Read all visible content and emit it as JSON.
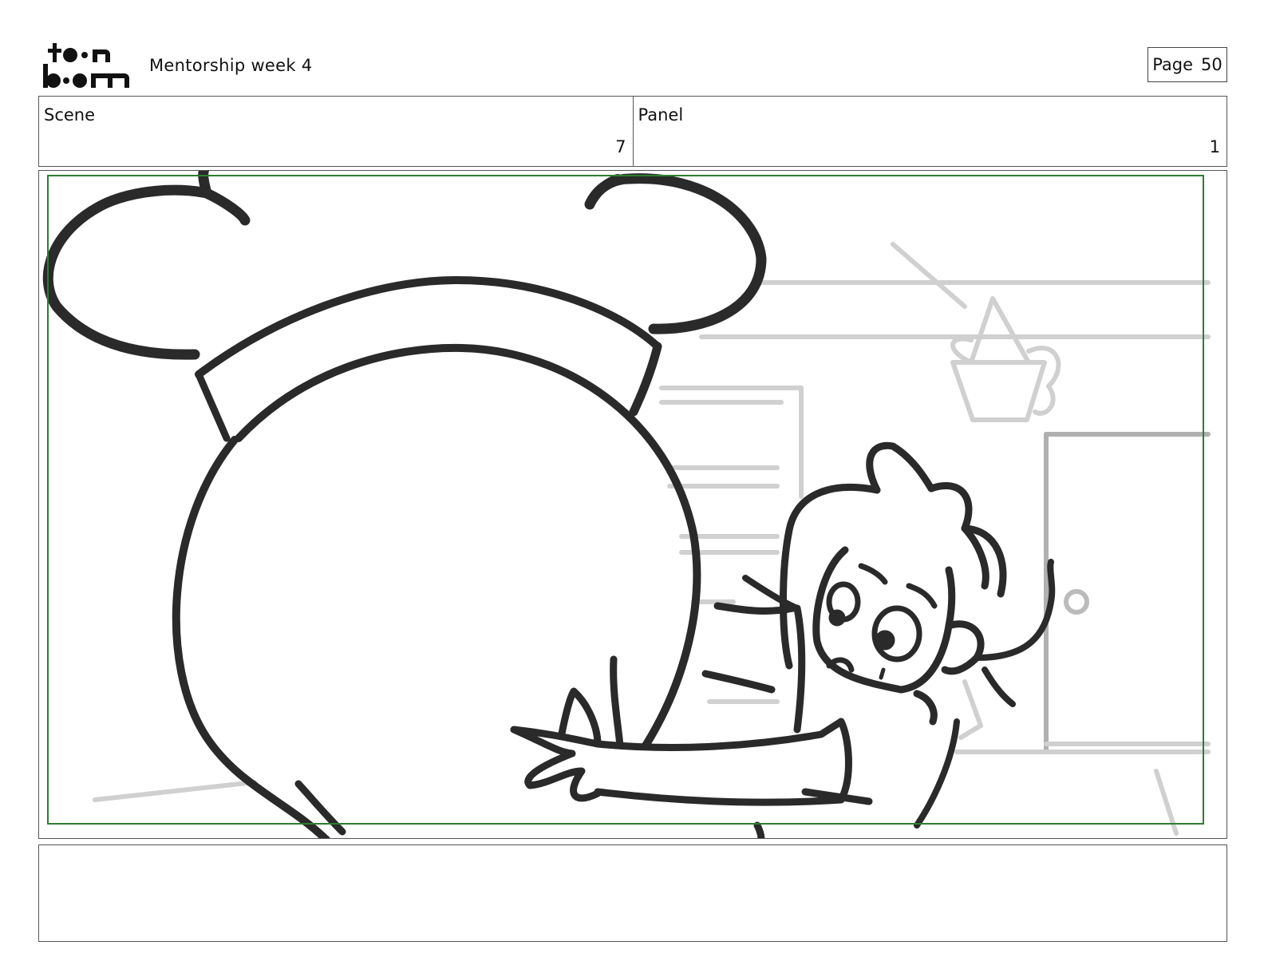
{
  "header": {
    "logo_text": "toon boom",
    "project_title": "Mentorship week 4",
    "page_label": "Page",
    "page_number": "50"
  },
  "info": {
    "scene_label": "Scene",
    "scene_value": "7",
    "panel_label": "Panel",
    "panel_value": "1"
  },
  "notes": {
    "text": ""
  },
  "colors": {
    "safe_frame": "#2e7d32",
    "ink": "#222222",
    "background_sketch": "#d0d0d0"
  }
}
